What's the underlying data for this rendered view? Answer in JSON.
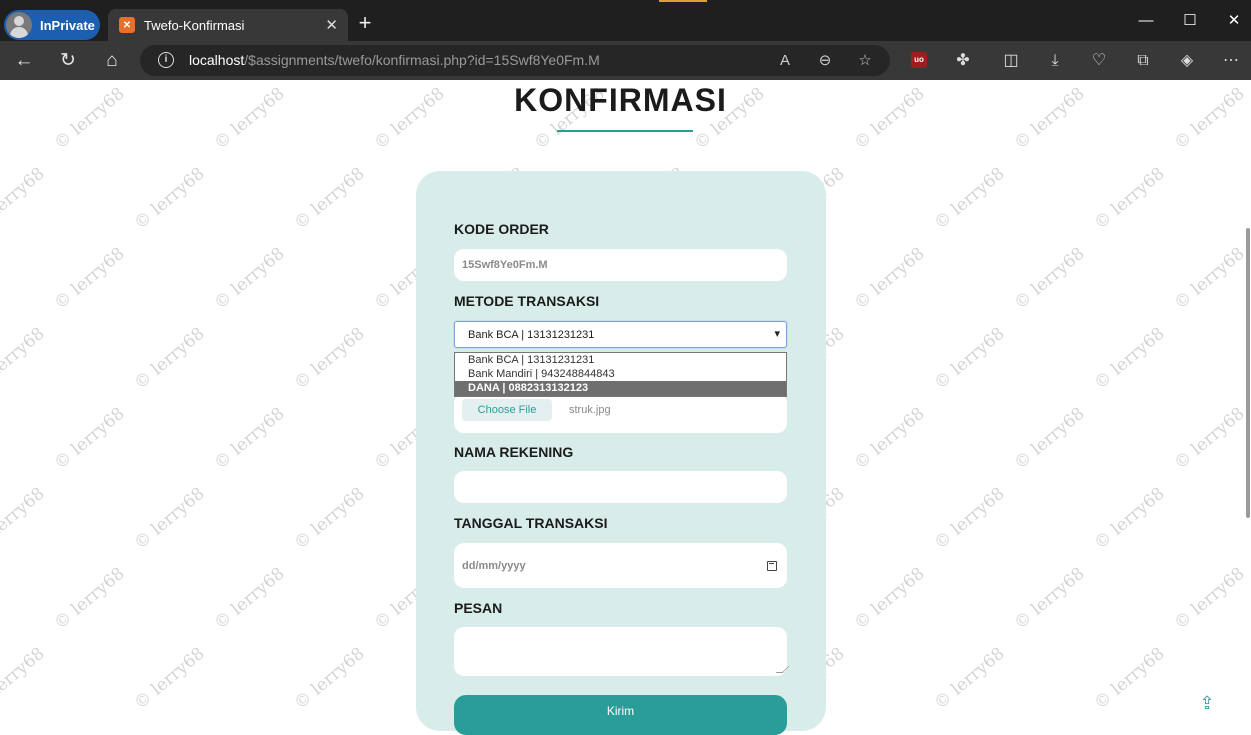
{
  "browser": {
    "inprivate_label": "InPrivate",
    "tab_title": "Twefo-Konfirmasi",
    "url_host": "localhost",
    "url_path": "/$assignments/twefo/konfirmasi.php?id=15Swf8Ye0Fm.M"
  },
  "page": {
    "title": "KONFIRMASI",
    "watermark": "© lerry68"
  },
  "form": {
    "kode_order_label": "KODE ORDER",
    "kode_order_value": "15Swf8Ye0Fm.M",
    "metode_label": "METODE TRANSAKSI",
    "metode_selected": "Bank BCA | 13131231231",
    "metode_options": [
      "Bank BCA | 13131231231",
      "Bank Mandiri | 943248844843",
      "DANA | 0882313132123"
    ],
    "choose_file_label": "Choose File",
    "file_name": "struk.jpg",
    "nama_rekening_label": "NAMA REKENING",
    "tanggal_label": "TANGGAL TRANSAKSI",
    "tanggal_placeholder": "dd/mm/yyyy",
    "pesan_label": "PESAN",
    "submit_label": "Kirim"
  },
  "colors": {
    "accent": "#2a9d98",
    "card_bg": "#d8ecea",
    "titlebar": "#1f1f1f",
    "toolbar": "#383838"
  }
}
